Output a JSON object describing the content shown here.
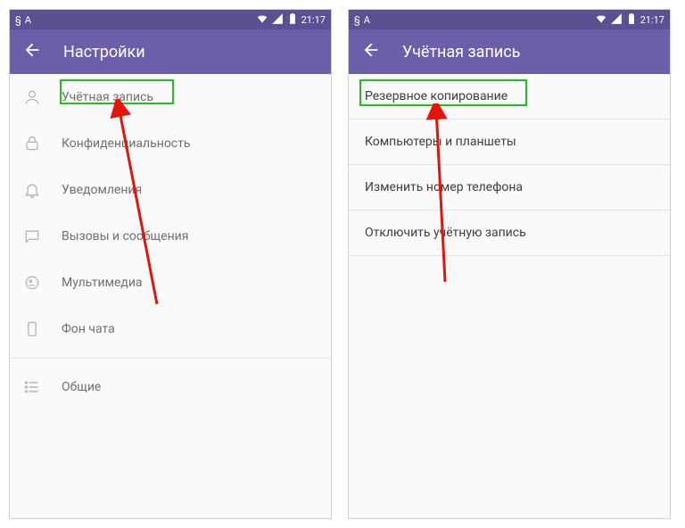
{
  "status": {
    "time": "21:17",
    "icon_left_a": "§",
    "icon_left_b": "A"
  },
  "left": {
    "title": "Настройки",
    "items": [
      {
        "label": "Учётная запись"
      },
      {
        "label": "Конфиденциальность"
      },
      {
        "label": "Уведомления"
      },
      {
        "label": "Вызовы и сообщения"
      },
      {
        "label": "Мультимедиа"
      },
      {
        "label": "Фон чата"
      },
      {
        "label": "Общие"
      }
    ]
  },
  "right": {
    "title": "Учётная запись",
    "items": [
      {
        "label": "Резервное копирование"
      },
      {
        "label": "Компьютеры и планшеты"
      },
      {
        "label": "Изменить номер телефона"
      },
      {
        "label": "Отключить учётную запись"
      }
    ]
  },
  "annotation": {
    "color": "#e4140a"
  }
}
